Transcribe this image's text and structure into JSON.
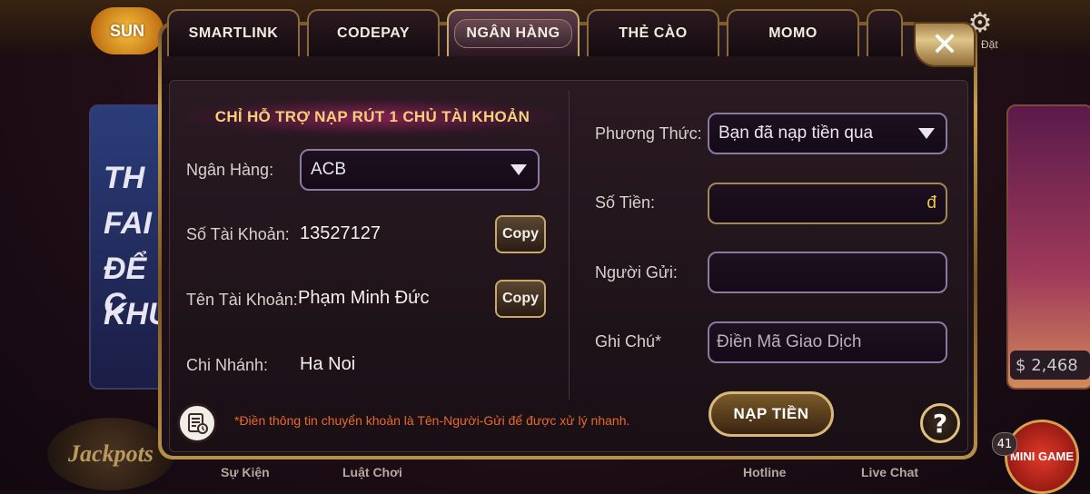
{
  "background": {
    "logo_text": "SUN",
    "settings_label": "Đặt",
    "promo_left_text": [
      "TH",
      "FAI",
      "ĐỂ C",
      "KHU"
    ],
    "coin_value": "2,468",
    "jackpot_label": "Jackpots",
    "minigame_label": "MINI GAME",
    "minigame_badge": "41",
    "bottom_nav": [
      "Sự Kiện",
      "Luật Chơi",
      "Hotline",
      "Live Chat"
    ]
  },
  "tabs": [
    {
      "label": "SMARTLINK",
      "active": false
    },
    {
      "label": "CODEPAY",
      "active": false
    },
    {
      "label": "NGÂN HÀNG",
      "active": true
    },
    {
      "label": "THẺ CÀO",
      "active": false
    },
    {
      "label": "MOMO",
      "active": false
    }
  ],
  "close_label": "✕",
  "banner": "CHỈ HỖ TRỢ NẠP RÚT 1 CHỦ TÀI KHOẢN",
  "bank_info": {
    "bank_label": "Ngân Hàng:",
    "bank_value": "ACB",
    "account_no_label": "Số Tài Khoản:",
    "account_no_value": "13527127",
    "account_name_label": "Tên Tài Khoản:",
    "account_name_value": "Phạm Minh Đức",
    "branch_label": "Chi Nhánh:",
    "branch_value": "Ha Noi",
    "copy_label": "Copy"
  },
  "form": {
    "method_label": "Phương Thức:",
    "method_value": "Bạn đã nạp tiền qua",
    "amount_label": "Số Tiền:",
    "amount_value": "",
    "currency_symbol": "đ",
    "sender_label": "Người Gửi:",
    "sender_value": "",
    "note_label": "Ghi Chú*",
    "note_placeholder": "Điền Mã Giao Dịch",
    "submit_label": "NẠP TIỀN"
  },
  "footer_note": "*Điền thông tin chuyển khoản là Tên-Người-Gửi để được xử lý nhanh.",
  "help_label": "?",
  "colors": {
    "accent_gold": "#c9a86a",
    "banner_text": "#f7d07a",
    "note_text": "#e86a2a",
    "panel_bg": "#1d1119"
  }
}
